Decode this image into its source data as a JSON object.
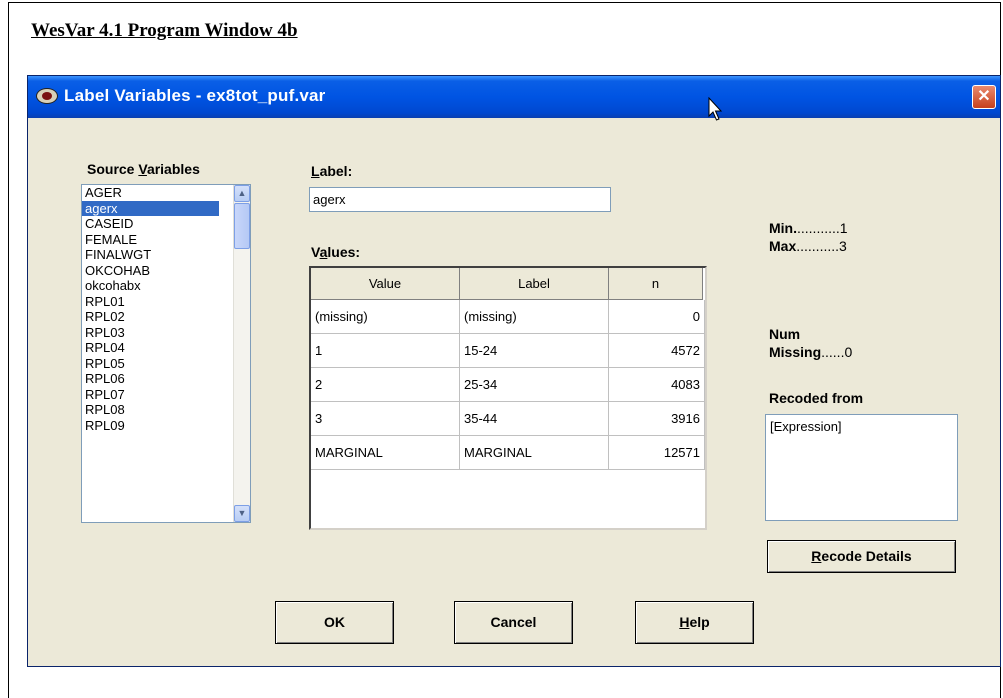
{
  "document": {
    "title": "WesVar 4.1 Program Window 4b"
  },
  "window": {
    "title": "Label Variables - ex8tot_puf.var",
    "close_glyph": "✕"
  },
  "source_variables": {
    "label_pre": "Source ",
    "label_u": "V",
    "label_post": "ariables",
    "items": [
      "AGER",
      "agerx",
      "CASEID",
      "FEMALE",
      "FINALWGT",
      "OKCOHAB",
      "okcohabx",
      "RPL01",
      "RPL02",
      "RPL03",
      "RPL04",
      "RPL05",
      "RPL06",
      "RPL07",
      "RPL08",
      "RPL09"
    ],
    "selected_index": 1
  },
  "label_field": {
    "label_u": "L",
    "label_post": "abel:",
    "value": "agerx"
  },
  "values": {
    "label_pre": "V",
    "label_u": "a",
    "label_post": "lues:",
    "columns": [
      "Value",
      "Label",
      "n"
    ],
    "rows": [
      [
        "(missing)",
        "(missing)",
        "0"
      ],
      [
        "1",
        "15-24",
        "4572"
      ],
      [
        "2",
        "25-34",
        "4083"
      ],
      [
        "3",
        "35-44",
        "3916"
      ],
      [
        "MARGINAL",
        "MARGINAL",
        "12571"
      ]
    ]
  },
  "stats": {
    "min_label": "Min.",
    "min_dots": "...........1",
    "max_label": "Max",
    "max_dots": "...........3",
    "num_label": "Num",
    "missing_label": "Missing",
    "missing_dots": "......0"
  },
  "recoded": {
    "label": "Recoded from",
    "value": "[Expression]"
  },
  "buttons": {
    "recode_u": "R",
    "recode_post": "ecode Details",
    "ok": "OK",
    "cancel": "Cancel",
    "help_u": "H",
    "help_post": "elp"
  },
  "icons": {
    "up_arrow": "▲",
    "down_arrow": "▼"
  }
}
